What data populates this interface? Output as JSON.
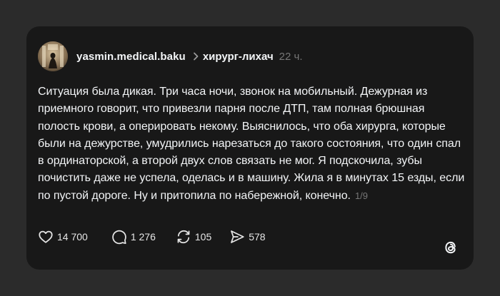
{
  "post": {
    "username": "yasmin.medical.baku",
    "topic": "хирург-лихач",
    "time": "22 ч.",
    "text": "Ситуация была дикая. Три часа ночи, звонок на мобильный. Дежурная из приемного говорит, что привезли парня после ДТП, там полная брюшная полость крови, а оперировать некому. Выяснилось, что оба хирурга, которые были на дежурстве, умудрились нарезаться до такого состояния, что один спал в ординаторской, а второй двух слов связать не мог. Я подскочила, зубы почистить даже не успела, оделась и в машину. Жила я в минутах 15 езды, если по пустой дороге. Ну и притопила по набережной, конечно.",
    "page_counter": "1/9"
  },
  "actions": {
    "likes": "14 700",
    "replies": "1 276",
    "reposts": "105",
    "shares": "578"
  },
  "icons": {
    "like": "heart-icon",
    "reply": "comment-bubble-icon",
    "repost": "repost-arrows-icon",
    "share": "send-icon",
    "brand": "threads-logo-icon",
    "separator": "chevron-right-icon"
  },
  "colors": {
    "background": "#2b2b2b",
    "card": "#181818",
    "text": "#f3f5f7",
    "muted": "#777777"
  }
}
